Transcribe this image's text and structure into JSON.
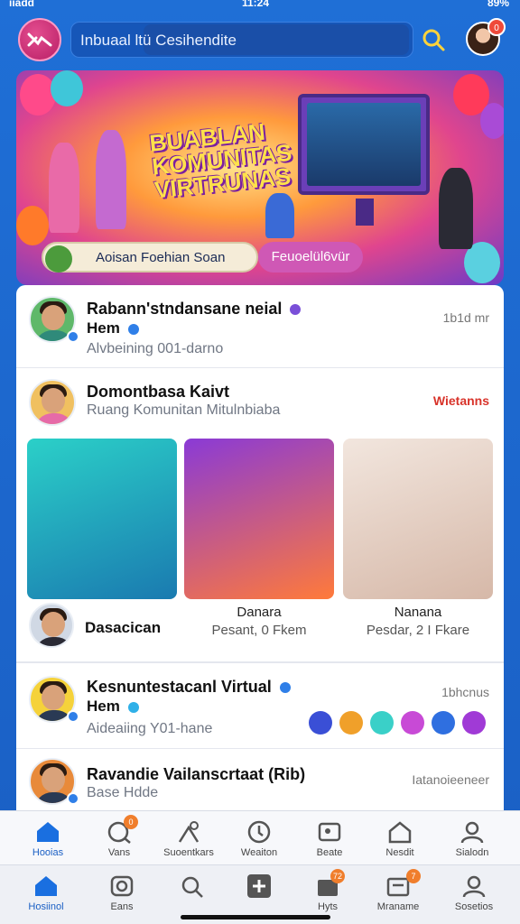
{
  "status_bar": {
    "carrier": "iiadd",
    "time": "11:24",
    "battery": "89%"
  },
  "header": {
    "search_text": "Inbuaal ltü Cesihendite",
    "notification_count": "0"
  },
  "hero": {
    "title": "BUABLAN\nKOMUNITAS\nVIRTRUNAS",
    "left_button": "Aoisan Foehian Soan",
    "right_button": "Feuoelül6vür"
  },
  "feed": [
    {
      "name_line1": "Rabann'stndansane neial",
      "name_line2": "Hem",
      "subtitle": "Alvbeining 001-darno",
      "meta": "1b1d mr"
    },
    {
      "name_line1": "Domontbasa Kaivt",
      "subtitle": "Ruang Komunitan Mitulnbiaba",
      "meta": "Wietanns",
      "post_captions": [
        {
          "title": "Dasacican",
          "sub": ""
        },
        {
          "title": "Danara",
          "sub": "Pesant, 0 Fkem"
        },
        {
          "title": "Nanana",
          "sub": "Pesdar, 2 I Fkare"
        }
      ]
    },
    {
      "name_line1": "Kesnuntestacanl Virtual",
      "name_line2": "Hem",
      "subtitle": "Aideaiing Y01-hane",
      "meta": "1bhcnus"
    },
    {
      "name_line1": "Ravandie Vailanscrtaat (Rib)",
      "subtitle": "Base Hdde",
      "meta": "Iatanoieeneer"
    }
  ],
  "tab_bar_top": [
    {
      "label": "Hooias",
      "icon": "home-icon",
      "active": true
    },
    {
      "label": "Vans",
      "icon": "chat-icon",
      "badge": "0"
    },
    {
      "label": "Suoentkars",
      "icon": "community-icon"
    },
    {
      "label": "Weaiton",
      "icon": "compass-icon"
    },
    {
      "label": "Beate",
      "icon": "gallery-icon"
    },
    {
      "label": "Nesdit",
      "icon": "house-outline-icon"
    },
    {
      "label": "Sialodn",
      "icon": "profile-icon"
    }
  ],
  "tab_bar_bottom": [
    {
      "label": "Hosiinol",
      "icon": "home-icon",
      "active": true
    },
    {
      "label": "Eans",
      "icon": "camera-icon"
    },
    {
      "label": "",
      "icon": "search-icon"
    },
    {
      "label": "",
      "icon": "plus-icon"
    },
    {
      "label": "Hyts",
      "icon": "box-icon",
      "badge": "72"
    },
    {
      "label": "Mraname",
      "icon": "message-icon",
      "badge": "7"
    },
    {
      "label": "Sosetios",
      "icon": "profile-icon"
    }
  ]
}
